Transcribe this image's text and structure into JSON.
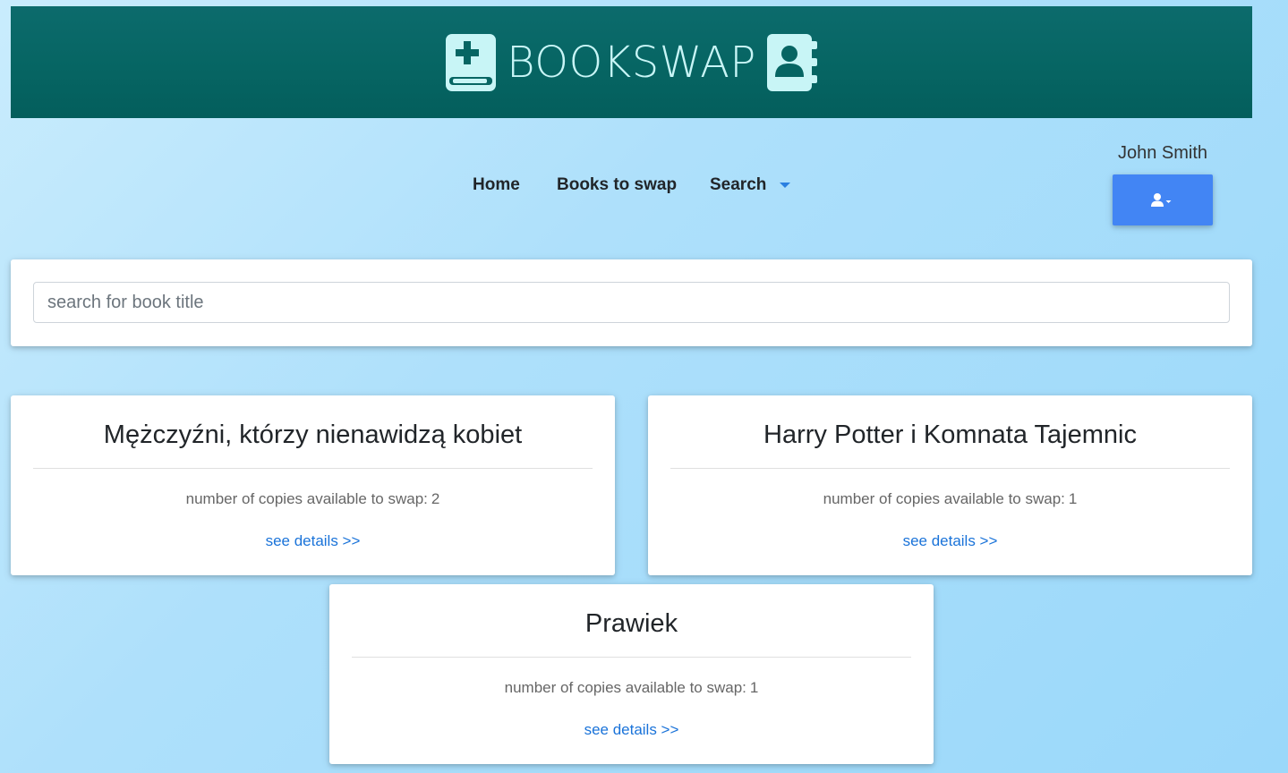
{
  "header": {
    "brand": "BOOKSWAP",
    "left_icon": "book-medical-icon",
    "right_icon": "address-book-icon"
  },
  "nav": {
    "home": "Home",
    "books_to_swap": "Books to swap",
    "search": "Search"
  },
  "user": {
    "name": "John Smith",
    "button_icon": "user-dropdown-icon"
  },
  "search": {
    "placeholder": "search for book title",
    "value": ""
  },
  "books": [
    {
      "title": "Mężczyźni, którzy nienawidzą kobiet",
      "copies_label": "number of copies available to swap:",
      "copies": "2",
      "link": "see details >>"
    },
    {
      "title": "Harry Potter i Komnata Tajemnic",
      "copies_label": "number of copies available to swap:",
      "copies": "1",
      "link": "see details >>"
    },
    {
      "title": "Prawiek",
      "copies_label": "number of copies available to swap:",
      "copies": "1",
      "link": "see details >>"
    }
  ],
  "colors": {
    "banner": "#066563",
    "brand_text": "#c8f5f6",
    "accent": "#4285f4",
    "link": "#1a73d9",
    "background": "#aee0fb"
  }
}
